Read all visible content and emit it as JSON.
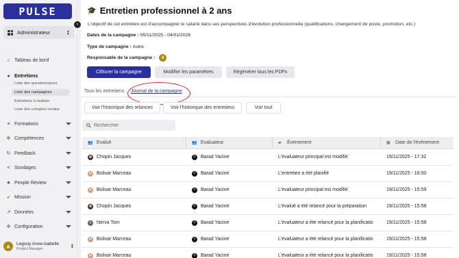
{
  "brand": {
    "logo_text": "PULSE"
  },
  "sidebar": {
    "role": "Administrateur",
    "nav": [
      {
        "label": "Tableau de bord",
        "icon": "home-icon"
      },
      {
        "label": "Entretiens",
        "icon": "chat-icon"
      },
      {
        "label": "Formations",
        "icon": "database-icon"
      },
      {
        "label": "Compétences",
        "icon": "gear-icon"
      },
      {
        "label": "Feedback",
        "icon": "refresh-icon"
      },
      {
        "label": "Sondages",
        "icon": "share-icon"
      },
      {
        "label": "People Review",
        "icon": "star-icon"
      },
      {
        "label": "Mission",
        "icon": "rocket-icon"
      },
      {
        "label": "Données",
        "icon": "chart-icon"
      },
      {
        "label": "Configuration",
        "icon": "gear-icon"
      }
    ],
    "sub": [
      "Liste des questionnaires",
      "Liste des campagnes",
      "Entretiens à réaliser",
      "Liste des comptes rendus"
    ],
    "user": {
      "name": "Legouy Anne-isabelle",
      "job": "Product Manager",
      "initial": "A"
    }
  },
  "page": {
    "title": "Entretien professionnel à 2 ans",
    "description": "L'objectif de cet entretien est d'accompagner le salarié dans ses perspectives d'évolution professionnelle (qualifications, changement de poste, promotion, etc.)",
    "dates_label": "Dates de la campagne :",
    "dates_value": "05/11/2025 - 04/01/2026",
    "type_label": "Type de campagne :",
    "type_value": "Autre",
    "resp_label": "Responsable de la campagne :",
    "resp_initial": "A",
    "buttons": {
      "close": "Clôturer la campagne",
      "edit": "Modifier les paramètres",
      "regen": "Régénérer tous les PDFs"
    },
    "tabs": [
      "Tous les entretiens",
      "Journal de la campagne"
    ],
    "filters": [
      "Voir l'historique des relances",
      "Voir l'historique des entretiens",
      "Voir tout"
    ],
    "search_placeholder": "Rechercher"
  },
  "table": {
    "headers": [
      "Evalué",
      "Evaluateur",
      "Événement",
      "Date de l'événement"
    ],
    "rows": [
      [
        "Chopin Jacques",
        "Barad Yacine",
        "L'évaluateur principal est modifié",
        "19/11/2025 - 17:32"
      ],
      [
        "Bolivar Marceau",
        "Barad Yacine",
        "L'entretien a été planifié",
        "19/11/2025 - 16:00"
      ],
      [
        "Bolivar Marceau",
        "Barad Yacine",
        "L'évaluateur principal est modifié",
        "19/11/2025 - 15:59"
      ],
      [
        "Chopin Jacques",
        "Barad Yacine",
        "L'évalué a été relancé pour la préparation",
        "19/11/2025 - 15:58"
      ],
      [
        "Nerva Tom",
        "Barad Yacine",
        "L'évaluateur a été relancé pour la planificatio",
        "19/11/2025 - 15:58"
      ],
      [
        "Bolivar Marceau",
        "Barad Yacine",
        "L'évaluateur a été relancé pour la planificatio",
        "19/11/2025 - 15:58"
      ],
      [
        "Bolivar Marceau",
        "Barad Yacine",
        "L'évaluateur a été relancé pour la planificatio",
        "19/11/2025 - 15:58"
      ]
    ]
  }
}
